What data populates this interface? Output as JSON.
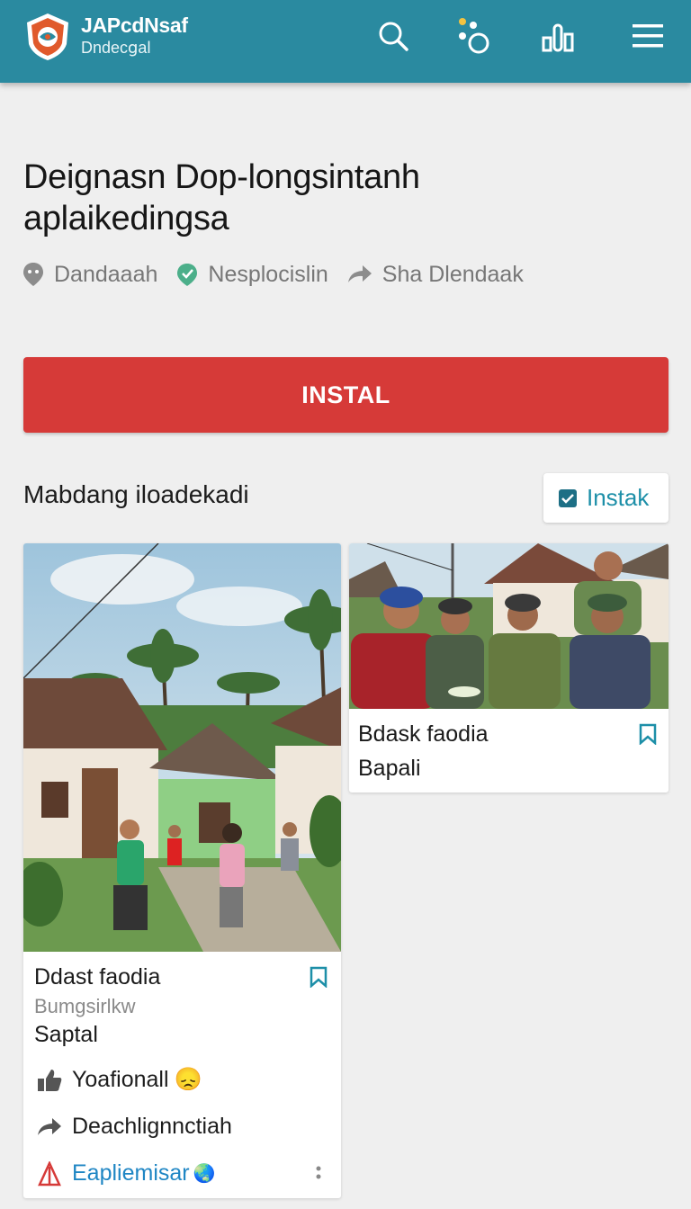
{
  "header": {
    "app_name": "JAPcdNsaf",
    "app_subtitle": "Dndecցal",
    "icons": [
      "logo-shield-icon",
      "search-icon",
      "dots-cluster-icon",
      "chart-icon",
      "menu-icon"
    ],
    "bar_color": "#2a8aa0"
  },
  "page": {
    "title_line1": "Deignasn Dop-longsintanh",
    "title_line2": "aplaikedingsa",
    "meta": [
      {
        "icon": "pin-icon",
        "label": "Dandaaah"
      },
      {
        "icon": "check-badge-icon",
        "label": "Nesplocislin"
      },
      {
        "icon": "share-arrow-icon",
        "label": "Sha Dlendaak"
      }
    ]
  },
  "install_button": {
    "label": "INSTAL",
    "color": "#d63a38"
  },
  "section": {
    "title": "Mabdang iloadekadi",
    "chip_label": "Instak"
  },
  "cards": [
    {
      "title": "Ddast faodia",
      "subtitle": "Bumgsirlkw",
      "line": "Saptal",
      "actions": [
        {
          "icon": "thumbs-up-icon",
          "label": "Yoafionall",
          "emoji": "😞"
        },
        {
          "icon": "share-arrow-icon",
          "label": "Deachlignnctiah"
        },
        {
          "icon": "app-logo-icon",
          "label": "Eapliemisar",
          "emoji": "🌏"
        }
      ]
    },
    {
      "title": "Bdask faodia",
      "line": "Bapali"
    }
  ],
  "colors": {
    "accent": "#1d8fa8",
    "link_blue": "#1f86c4",
    "background": "#efefef"
  }
}
